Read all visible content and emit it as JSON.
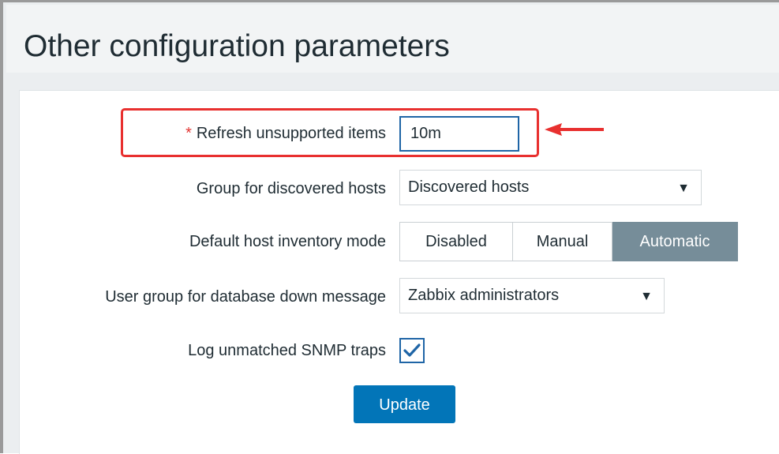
{
  "page": {
    "title": "Other configuration parameters"
  },
  "form": {
    "refresh_unsupported": {
      "required_mark": "*",
      "label": "Refresh unsupported items",
      "value": "10m"
    },
    "group_discovered_hosts": {
      "label": "Group for discovered hosts",
      "value": "Discovered hosts"
    },
    "inventory_mode": {
      "label": "Default host inventory mode",
      "options": [
        "Disabled",
        "Manual",
        "Automatic"
      ],
      "selected": "Automatic"
    },
    "db_down_user_group": {
      "label": "User group for database down message",
      "value": "Zabbix administrators"
    },
    "log_snmp_traps": {
      "label": "Log unmatched SNMP traps",
      "checked": true
    },
    "update_label": "Update"
  },
  "annotation": {
    "highlight_color": "#e8302f"
  },
  "colors": {
    "primary": "#0275b8",
    "segment_active": "#768d99",
    "required": "#e33734"
  },
  "icons": {
    "dropdown": "caret-down-icon",
    "checkbox": "checkmark-icon",
    "annotation": "red-arrow-icon"
  }
}
